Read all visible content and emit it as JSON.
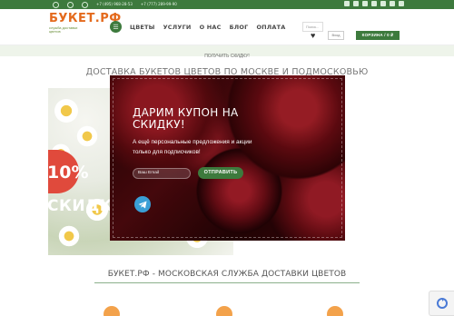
{
  "topbar": {
    "phone_primary": "+7 (495) 968-28-53",
    "phone_secondary": "+7 (777) 289-99-90",
    "background_color": "#3d7a3d"
  },
  "header": {
    "logo_title": "БУКЕТ.РФ",
    "logo_subtitle": "служба доставки цветов",
    "search_placeholder": "Поиск...",
    "login_label": "Вход",
    "cart_label": "КОРЗИНА / 0 ₽"
  },
  "nav": {
    "items": [
      "ЦВЕТЫ",
      "УСЛУГИ",
      "О НАС",
      "БЛОГ",
      "ОПЛАТА"
    ]
  },
  "promo": {
    "text": "ПОЛУЧИТЬ СКИДКУ!"
  },
  "page": {
    "title": "ДОСТАВКА БУКЕТОВ ЦВЕТОВ ПО МОСКВЕ И ПОДМОСКОВЬЮ",
    "section_title": "БУКЕТ.РФ - МОСКОВСКАЯ СЛУЖБА ДОСТАВКИ ЦВЕТОВ"
  },
  "banner": {
    "percent": "10%",
    "word": "СКИДКИ"
  },
  "modal": {
    "title": "ДАРИМ КУПОН НА СКИДКУ!",
    "text": "А ещё персональные предложения и акции только для подписчиков!",
    "email_placeholder": "Ваш Email",
    "submit_label": "ОТПРАВИТЬ"
  },
  "colors": {
    "brand_green": "#3d7a3d",
    "brand_orange": "#e46a1d",
    "sale_red": "#e04a3c"
  }
}
